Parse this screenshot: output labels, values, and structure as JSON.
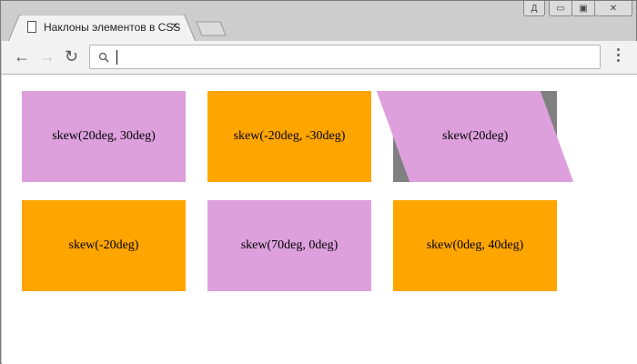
{
  "browser": {
    "tab_title": "Наклоны элементов в CSS",
    "close": "×",
    "profile_label": "Д",
    "address_value": ""
  },
  "colors": {
    "pink": "#dda0dd",
    "orange": "#ffa500",
    "gray": "#808080"
  },
  "boxes": [
    {
      "label": "skew(20deg, 30deg)",
      "color": "pink"
    },
    {
      "label": "skew(-20deg, -30deg)",
      "color": "orange"
    },
    {
      "label": "skew(20deg)",
      "color": "pink"
    },
    {
      "label": "skew(-20deg)",
      "color": "orange"
    },
    {
      "label": "skew(70deg, 0deg)",
      "color": "pink"
    },
    {
      "label": "skew(0deg, 40deg)",
      "color": "orange"
    }
  ]
}
